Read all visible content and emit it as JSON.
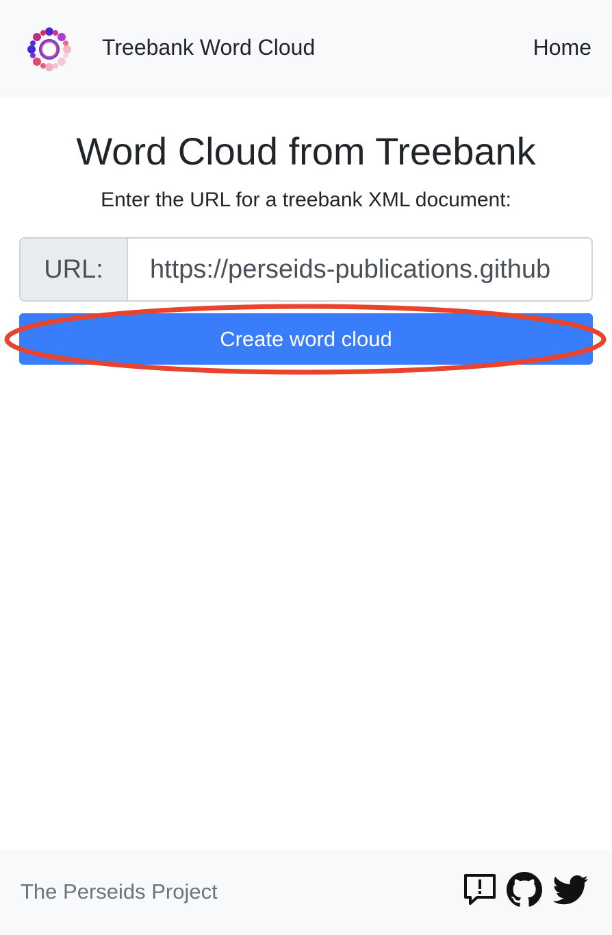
{
  "header": {
    "brand": "Treebank Word Cloud",
    "nav_home": "Home",
    "logo_icon": "perseids-flower-logo"
  },
  "main": {
    "title": "Word Cloud from Treebank",
    "instruction": "Enter the URL for a treebank XML document:",
    "url_label": "URL:",
    "url_value": "https://perseids-publications.github",
    "submit_label": "Create word cloud",
    "accent_color": "#3a7dfb",
    "annotation_color": "#e8432d"
  },
  "footer": {
    "text": "The Perseids Project",
    "icons": [
      "feedback-icon",
      "github-icon",
      "twitter-icon"
    ]
  }
}
